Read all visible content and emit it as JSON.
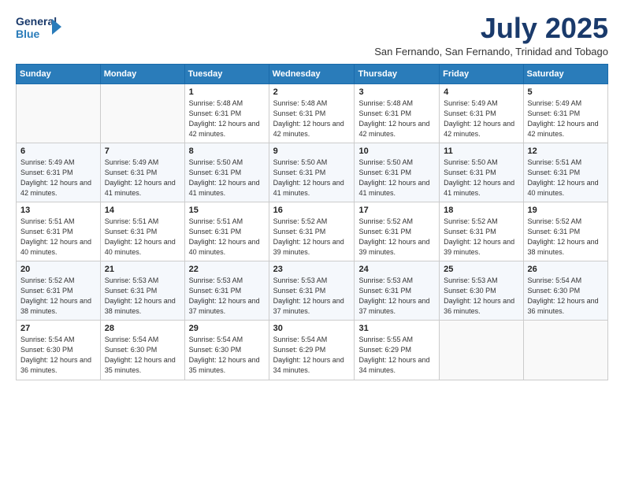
{
  "header": {
    "logo_line1": "General",
    "logo_line2": "Blue",
    "title": "July 2025",
    "subtitle": "San Fernando, San Fernando, Trinidad and Tobago"
  },
  "days_of_week": [
    "Sunday",
    "Monday",
    "Tuesday",
    "Wednesday",
    "Thursday",
    "Friday",
    "Saturday"
  ],
  "weeks": [
    [
      {
        "day": "",
        "detail": ""
      },
      {
        "day": "",
        "detail": ""
      },
      {
        "day": "1",
        "detail": "Sunrise: 5:48 AM\nSunset: 6:31 PM\nDaylight: 12 hours and 42 minutes."
      },
      {
        "day": "2",
        "detail": "Sunrise: 5:48 AM\nSunset: 6:31 PM\nDaylight: 12 hours and 42 minutes."
      },
      {
        "day": "3",
        "detail": "Sunrise: 5:48 AM\nSunset: 6:31 PM\nDaylight: 12 hours and 42 minutes."
      },
      {
        "day": "4",
        "detail": "Sunrise: 5:49 AM\nSunset: 6:31 PM\nDaylight: 12 hours and 42 minutes."
      },
      {
        "day": "5",
        "detail": "Sunrise: 5:49 AM\nSunset: 6:31 PM\nDaylight: 12 hours and 42 minutes."
      }
    ],
    [
      {
        "day": "6",
        "detail": "Sunrise: 5:49 AM\nSunset: 6:31 PM\nDaylight: 12 hours and 42 minutes."
      },
      {
        "day": "7",
        "detail": "Sunrise: 5:49 AM\nSunset: 6:31 PM\nDaylight: 12 hours and 41 minutes."
      },
      {
        "day": "8",
        "detail": "Sunrise: 5:50 AM\nSunset: 6:31 PM\nDaylight: 12 hours and 41 minutes."
      },
      {
        "day": "9",
        "detail": "Sunrise: 5:50 AM\nSunset: 6:31 PM\nDaylight: 12 hours and 41 minutes."
      },
      {
        "day": "10",
        "detail": "Sunrise: 5:50 AM\nSunset: 6:31 PM\nDaylight: 12 hours and 41 minutes."
      },
      {
        "day": "11",
        "detail": "Sunrise: 5:50 AM\nSunset: 6:31 PM\nDaylight: 12 hours and 41 minutes."
      },
      {
        "day": "12",
        "detail": "Sunrise: 5:51 AM\nSunset: 6:31 PM\nDaylight: 12 hours and 40 minutes."
      }
    ],
    [
      {
        "day": "13",
        "detail": "Sunrise: 5:51 AM\nSunset: 6:31 PM\nDaylight: 12 hours and 40 minutes."
      },
      {
        "day": "14",
        "detail": "Sunrise: 5:51 AM\nSunset: 6:31 PM\nDaylight: 12 hours and 40 minutes."
      },
      {
        "day": "15",
        "detail": "Sunrise: 5:51 AM\nSunset: 6:31 PM\nDaylight: 12 hours and 40 minutes."
      },
      {
        "day": "16",
        "detail": "Sunrise: 5:52 AM\nSunset: 6:31 PM\nDaylight: 12 hours and 39 minutes."
      },
      {
        "day": "17",
        "detail": "Sunrise: 5:52 AM\nSunset: 6:31 PM\nDaylight: 12 hours and 39 minutes."
      },
      {
        "day": "18",
        "detail": "Sunrise: 5:52 AM\nSunset: 6:31 PM\nDaylight: 12 hours and 39 minutes."
      },
      {
        "day": "19",
        "detail": "Sunrise: 5:52 AM\nSunset: 6:31 PM\nDaylight: 12 hours and 38 minutes."
      }
    ],
    [
      {
        "day": "20",
        "detail": "Sunrise: 5:52 AM\nSunset: 6:31 PM\nDaylight: 12 hours and 38 minutes."
      },
      {
        "day": "21",
        "detail": "Sunrise: 5:53 AM\nSunset: 6:31 PM\nDaylight: 12 hours and 38 minutes."
      },
      {
        "day": "22",
        "detail": "Sunrise: 5:53 AM\nSunset: 6:31 PM\nDaylight: 12 hours and 37 minutes."
      },
      {
        "day": "23",
        "detail": "Sunrise: 5:53 AM\nSunset: 6:31 PM\nDaylight: 12 hours and 37 minutes."
      },
      {
        "day": "24",
        "detail": "Sunrise: 5:53 AM\nSunset: 6:31 PM\nDaylight: 12 hours and 37 minutes."
      },
      {
        "day": "25",
        "detail": "Sunrise: 5:53 AM\nSunset: 6:30 PM\nDaylight: 12 hours and 36 minutes."
      },
      {
        "day": "26",
        "detail": "Sunrise: 5:54 AM\nSunset: 6:30 PM\nDaylight: 12 hours and 36 minutes."
      }
    ],
    [
      {
        "day": "27",
        "detail": "Sunrise: 5:54 AM\nSunset: 6:30 PM\nDaylight: 12 hours and 36 minutes."
      },
      {
        "day": "28",
        "detail": "Sunrise: 5:54 AM\nSunset: 6:30 PM\nDaylight: 12 hours and 35 minutes."
      },
      {
        "day": "29",
        "detail": "Sunrise: 5:54 AM\nSunset: 6:30 PM\nDaylight: 12 hours and 35 minutes."
      },
      {
        "day": "30",
        "detail": "Sunrise: 5:54 AM\nSunset: 6:29 PM\nDaylight: 12 hours and 34 minutes."
      },
      {
        "day": "31",
        "detail": "Sunrise: 5:55 AM\nSunset: 6:29 PM\nDaylight: 12 hours and 34 minutes."
      },
      {
        "day": "",
        "detail": ""
      },
      {
        "day": "",
        "detail": ""
      }
    ]
  ]
}
